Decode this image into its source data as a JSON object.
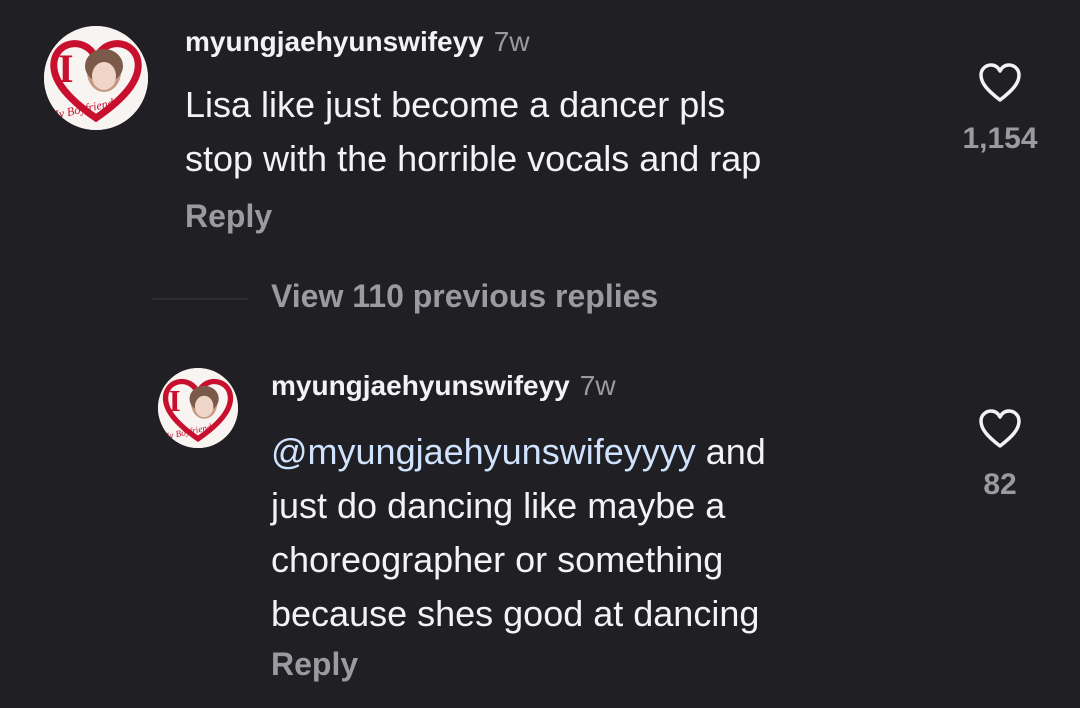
{
  "comments": [
    {
      "username": "myungjaehyunswifeyy",
      "time": "7w",
      "text_lines": [
        "Lisa like just become a dancer pls",
        "stop with the horrible vocals and rap"
      ],
      "reply_label": "Reply",
      "likes": "1,154",
      "avatar_text": "My Boyfriend",
      "avatar_big_letter": "I",
      "icons": {
        "like": "heart-outline-icon"
      }
    }
  ],
  "view_replies_label": "View 110 previous replies",
  "replies": [
    {
      "username": "myungjaehyunswifeyy",
      "time": "7w",
      "mention": "@myungjaehyunswifeyyyy",
      "text_first_rest": " and",
      "text_lines": [
        "just do dancing like maybe a",
        "choreographer or something",
        "because shes good at dancing"
      ],
      "reply_label": "Reply",
      "likes": "82",
      "avatar_text": "My Boyfriend",
      "avatar_big_letter": "I",
      "icons": {
        "like": "heart-outline-icon",
        "mention": "threads-at-icon"
      }
    }
  ],
  "colors": {
    "background": "#202024",
    "text_primary": "#f3f3f5",
    "text_secondary": "#9a9aa0",
    "avatar_heart": "#c8102e"
  }
}
